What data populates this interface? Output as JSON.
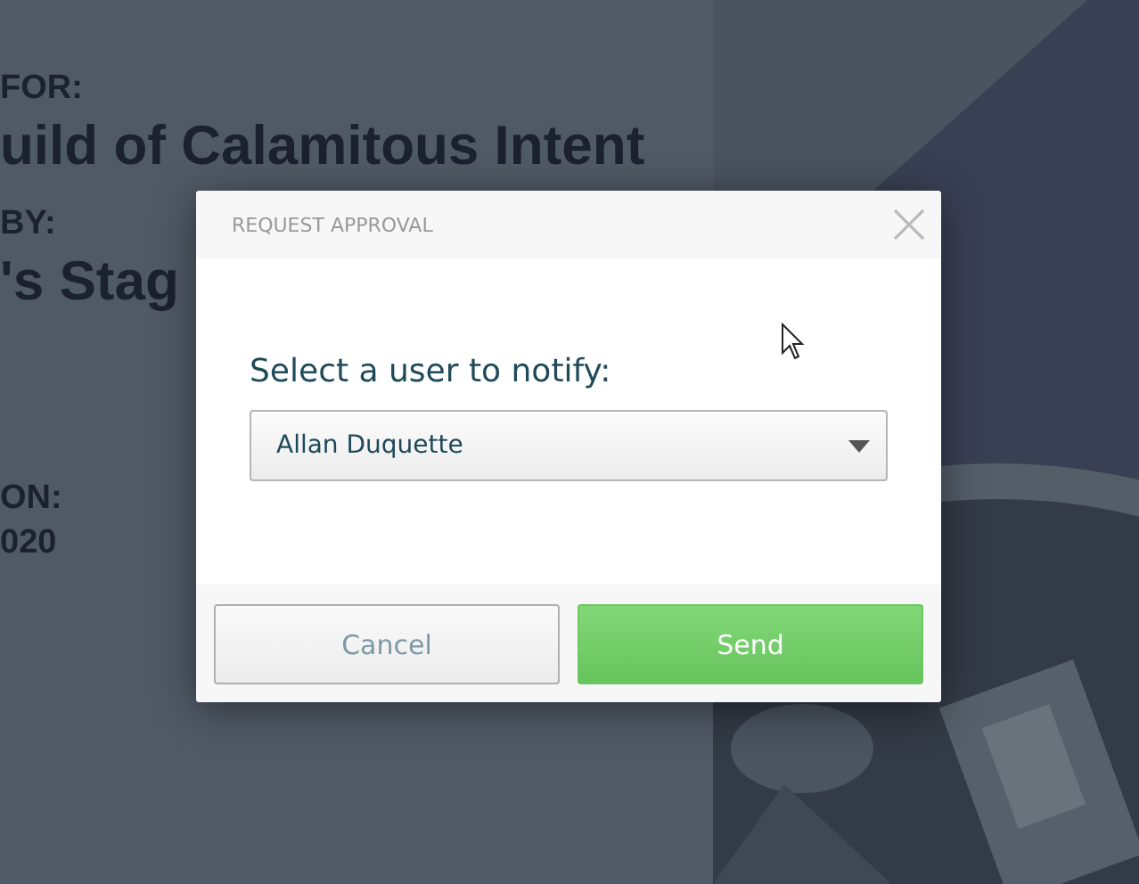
{
  "page": {
    "fields": [
      {
        "label": "FOR:",
        "value": "uild of Calamitous Intent",
        "kind": "large"
      },
      {
        "label": "BY:",
        "value": "'s Stag",
        "kind": "large"
      },
      {
        "label": "ON:",
        "value": "020",
        "kind": "small"
      }
    ]
  },
  "dialog": {
    "title": "REQUEST APPROVAL",
    "prompt": "Select a user to notify:",
    "select": {
      "value": "Allan Duquette"
    },
    "buttons": [
      {
        "label": "Cancel",
        "kind": "secondary"
      },
      {
        "label": "Send",
        "kind": "primary"
      }
    ]
  }
}
